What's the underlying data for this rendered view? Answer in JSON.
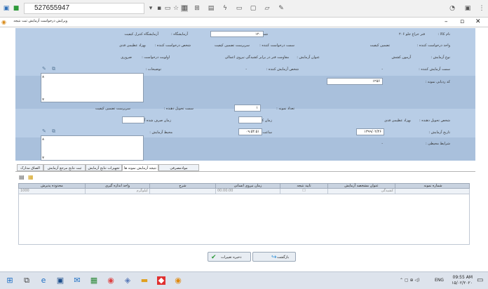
{
  "browser": {
    "address": "527655947"
  },
  "window": {
    "title": "ویرایش درخواست آزمایش ثبت نتیجه"
  },
  "form": {
    "kala_label": "نام کالا :",
    "kala_value": "فنر جراغ جلو ۲۰۶",
    "shomare_label": "شماره آزمایش :",
    "shomare_value": "۱۲۰",
    "azmayeshgah_label": "آزمایشگاه :",
    "azmayeshgah_value": "آزمایشگاه کنترل کیفیت",
    "vahed_label": "واحد درخواست کننده :",
    "vahed_value": "تضمین کیفیت",
    "semat_label": "سمت درخواست کننده :",
    "semat_value": "سرپرست تضمین کیفیت",
    "shakhs_label": "شخص درخواست کننده :",
    "shakhs_value": "بهزاد عظیمی فدی",
    "noe_label": "نوع آزمایش :",
    "noe_value": "آزمون کشش",
    "onvan_label": "عنوان آزمایش :",
    "onvan_value": "مقاومت فنر در برابر کشیدگی نیروی اعمالی",
    "olaviat_label": "اولویت درخواست :",
    "olaviat_value": "ضروری",
    "semat_azm_label": "سمت آزمایش کننده :",
    "semat_azm_value": "-",
    "shakhs_azm_label": "شخص آزمایش کننده :",
    "shakhs_azm_value": "-",
    "tozihat_label": "توضیحات :",
    "code_label": "کد ردیابی نمونه :",
    "code_value": "۱۲۵۶",
    "semat_tahvil_label": "سمت تحویل دهنده :",
    "semat_tahvil_value": "سرپرست تضمین کیفیت",
    "tedad_label": "تعداد نمونه :",
    "tedad_value": "۱",
    "shakhs_tahvil_label": "شخص تحویل دهنده :",
    "shakhs_tahvil_value": "بهزاد عظیمی فدی",
    "zaman_sarf_label": "زمان صرف شده آزمونگر :",
    "zaman_kol_label": "زمان کل آزمایش :",
    "saat_label": "ساعت آزمایش :",
    "saat_value": "۰۹:۵۴:۵۱",
    "tarikh_label": "تاریخ آزمایش :",
    "tarikh_value": "۱۳۹۹/۰۲/۲۶",
    "mohit_label": "محیط آزمایش :",
    "sharayet_label": "شرایط محیطی :",
    "sharayet_value": "-"
  },
  "tabs": [
    {
      "label": "موادمصرفی"
    },
    {
      "label": "نتیجه آزمایش نمونه ها"
    },
    {
      "label": "تجهیزات نتایج آزمایش"
    },
    {
      "label": "ثبت نتایج مرجع آزمایش"
    },
    {
      "label": "الصاق مدارک"
    }
  ],
  "grid": {
    "headers": [
      "شماره نمونه",
      "عنوان مشخصه آزمایش",
      "تایید نتیجه",
      "زمان نیروی انسانی",
      "شرح",
      "واحد اندازه گیری",
      "محدوده پذیرش"
    ],
    "row": [
      "",
      "کشیدگی",
      "",
      "00:00:00",
      "",
      "کیلوگرم",
      "1000"
    ]
  },
  "buttons": {
    "return": "بازگشت",
    "save": "ذخیره تغییرات"
  },
  "taskbar": {
    "lang": "ENG",
    "time": "09:55 AM",
    "date": "۱۵/۰۲/۲۰۲۰"
  },
  "colors": {
    "form_bg": "#b8cde6",
    "save_green": "#5cb85c"
  }
}
